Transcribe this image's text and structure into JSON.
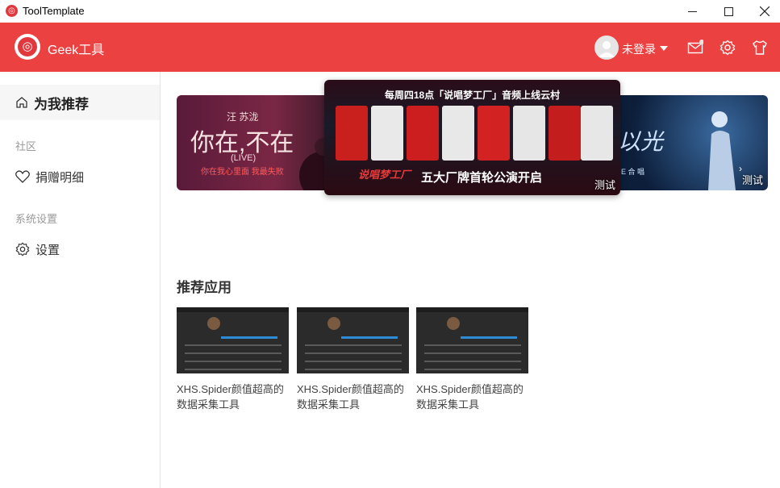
{
  "window": {
    "title": "ToolTemplate"
  },
  "header": {
    "brand": "Geek工具",
    "login_label": "未登录",
    "accent_color": "#ec4141"
  },
  "sidebar": {
    "items": [
      {
        "label": "为我推荐",
        "icon": "home-icon",
        "active": true
      }
    ],
    "sections": [
      {
        "label": "社区",
        "items": [
          {
            "label": "捐赠明细",
            "icon": "heart-icon"
          }
        ]
      },
      {
        "label": "系统设置",
        "items": [
          {
            "label": "设置",
            "icon": "gear-icon"
          }
        ]
      }
    ]
  },
  "banner": {
    "left": {
      "artist": "汪 苏泷",
      "title": "你在,不在",
      "live": "(LIVE)",
      "subtitle": "你在我心里面 我最失败"
    },
    "center": {
      "top_text": "每周四18点「说唱梦工厂」音频上线云村",
      "logo": "说唱梦工厂",
      "bottom_text": "五大厂牌首轮公演开启",
      "tag": "测试"
    },
    "right": {
      "title": "以光",
      "subtitle": "E 合 唱",
      "tag": "测试"
    }
  },
  "recommended": {
    "title": "推荐应用",
    "cards": [
      {
        "title": "XHS.Spider颜值超高的数据采集工具"
      },
      {
        "title": "XHS.Spider颜值超高的数据采集工具"
      },
      {
        "title": "XHS.Spider颜值超高的数据采集工具"
      }
    ]
  }
}
